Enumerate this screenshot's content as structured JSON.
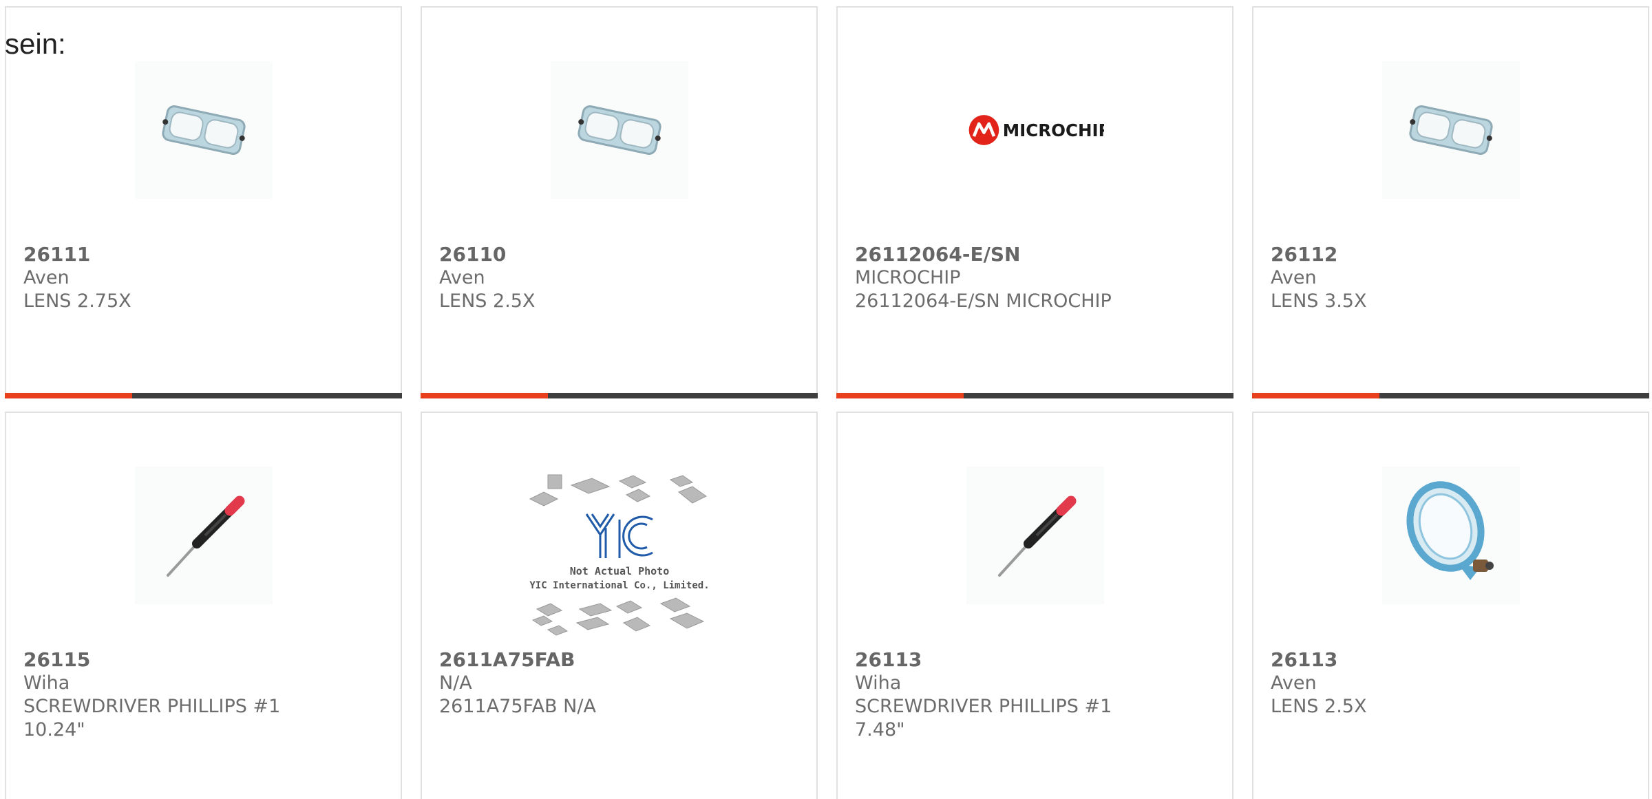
{
  "lead_text": "sein:",
  "colors": {
    "accent": "#e8401c",
    "bar": "#3f3f3f",
    "border": "#e1e1e1",
    "text": "#6c6c6c"
  },
  "products": [
    {
      "part": "26111",
      "brand": "Aven",
      "desc": "LENS 2.75X",
      "desc2": "",
      "image": "magnifier-lens-image",
      "progress": 0.32
    },
    {
      "part": "26110",
      "brand": "Aven",
      "desc": "LENS 2.5X",
      "desc2": "",
      "image": "magnifier-lens-image",
      "progress": 0.32
    },
    {
      "part": "26112064-E/SN",
      "brand": "MICROCHIP",
      "desc": "26112064-E/SN MICROCHIP",
      "desc2": "",
      "image": "microchip-logo",
      "logo_text": "MICROCHIP",
      "progress": 0.32
    },
    {
      "part": "26112",
      "brand": "Aven",
      "desc": "LENS 3.5X",
      "desc2": "",
      "image": "magnifier-lens-image",
      "progress": 0.32
    },
    {
      "part": "26115",
      "brand": "Wiha",
      "desc": "SCREWDRIVER PHILLIPS #1",
      "desc2": "10.24\"",
      "image": "screwdriver-image"
    },
    {
      "part": "2611A75FAB",
      "brand": "N/A",
      "desc": "2611A75FAB N/A",
      "desc2": "",
      "image": "not-actual-photo-placeholder",
      "placeholder_logo": "YIC",
      "placeholder_line1": "Not Actual Photo",
      "placeholder_line2": "YIC International Co., Limited."
    },
    {
      "part": "26113",
      "brand": "Wiha",
      "desc": "SCREWDRIVER PHILLIPS #1",
      "desc2": "7.48\"",
      "image": "screwdriver-image"
    },
    {
      "part": "26113",
      "brand": "Aven",
      "desc": "LENS 2.5X",
      "desc2": "",
      "image": "single-magnifier-lens-image"
    }
  ]
}
